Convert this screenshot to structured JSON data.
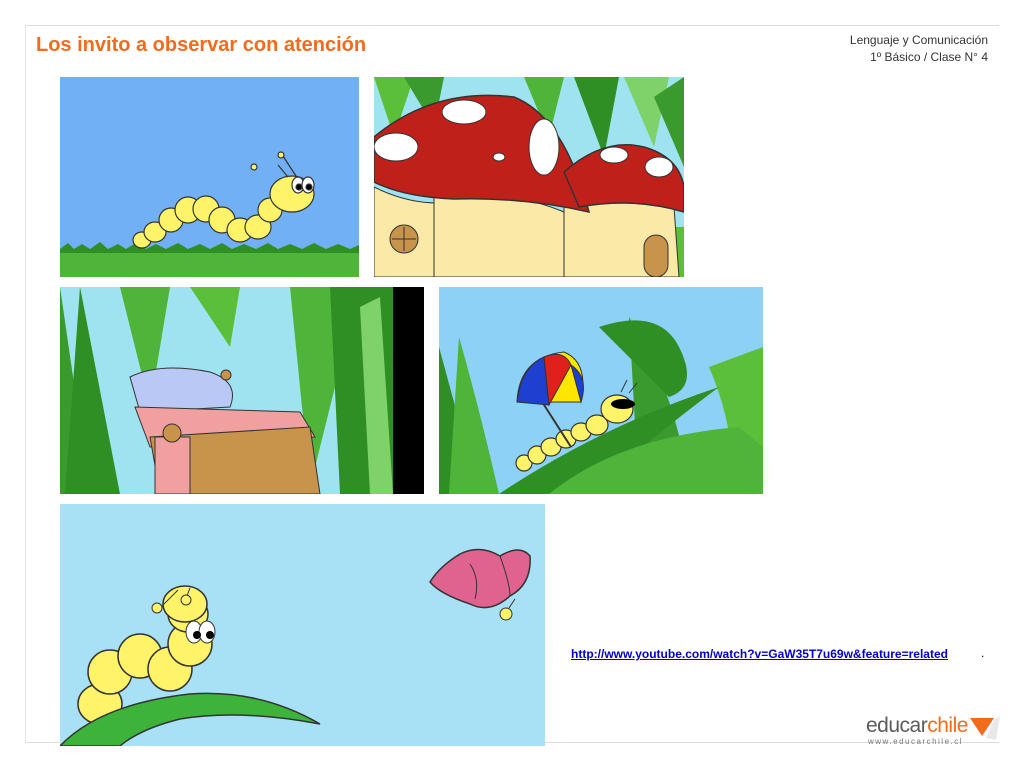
{
  "slide": {
    "title": "Los invito a observar con atención",
    "course": "Lenguaje y Comunicación",
    "lesson": "1º Básico / Clase N°  4"
  },
  "video_link": {
    "url_text": "http://www.youtube.com/watch?v=GaW35T7u69w&feature=related",
    "trailing": "."
  },
  "branding": {
    "logo_text_a": "educar",
    "logo_text_b": "chile",
    "logo_url": "www.educarchile.cl",
    "accent_color": "#f26b1d"
  },
  "images": [
    {
      "name": "caterpillar-on-grass-image"
    },
    {
      "name": "mushroom-houses-image"
    },
    {
      "name": "bed-in-grass-image"
    },
    {
      "name": "caterpillar-umbrella-image"
    },
    {
      "name": "caterpillar-butterfly-image"
    }
  ]
}
